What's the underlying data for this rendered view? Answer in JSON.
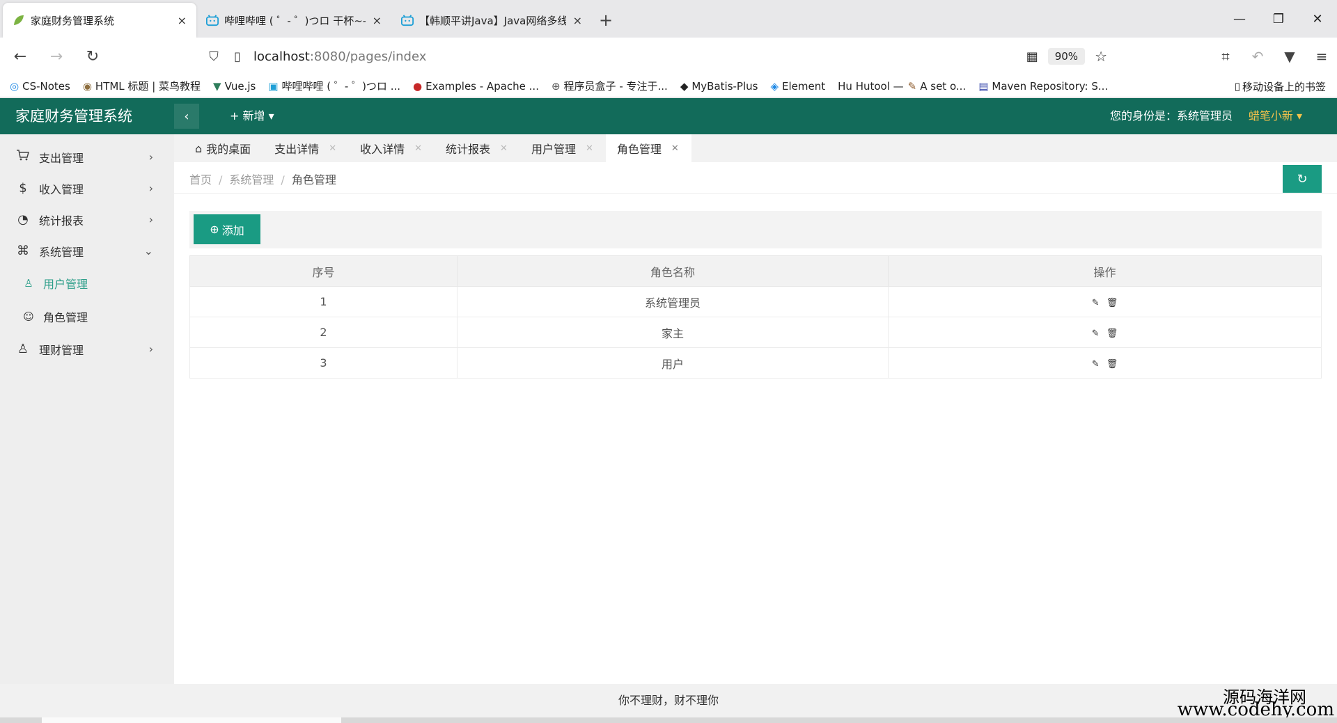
{
  "browser": {
    "tabs": [
      {
        "title": "家庭财务管理系统",
        "icon": "leaf-icon",
        "close": "×"
      },
      {
        "title": "哔哩哔哩 ( ゜- ゜)つロ 干杯~-bi",
        "icon": "bilibili-icon",
        "close": "×"
      },
      {
        "title": "【韩顺平讲Java】Java网络多线",
        "icon": "bilibili-icon",
        "close": "×"
      }
    ],
    "new_tab": "+",
    "url_host": "localhost",
    "url_rest": ":8080/pages/index",
    "zoom": "90%",
    "bookmarks": [
      {
        "label": "CS-Notes",
        "icon": "◎"
      },
      {
        "label": "HTML 标题 | 菜鸟教程",
        "icon": "◉"
      },
      {
        "label": "Vue.js",
        "icon": "▼"
      },
      {
        "label": "哔哩哔哩 ( ゜- ゜)つロ ...",
        "icon": "▣"
      },
      {
        "label": "Examples - Apache ...",
        "icon": "●"
      },
      {
        "label": "程序员盒子 - 专注于...",
        "icon": "⊕"
      },
      {
        "label": "MyBatis-Plus",
        "icon": "◆"
      },
      {
        "label": "Element",
        "icon": "◈"
      },
      {
        "label": "Hu Hutool —",
        "icon": ""
      },
      {
        "label": "A set o...",
        "icon": "✎"
      },
      {
        "label": "Maven Repository: S...",
        "icon": "▤"
      }
    ],
    "mobile_bookmarks": "移动设备上的书签"
  },
  "app": {
    "title": "家庭财务管理系统",
    "add_new": "+ 新增 ▾",
    "identity_label": "您的身份是：系统管理员",
    "username": "蜡笔小新 ▾"
  },
  "sidebar": {
    "items": [
      {
        "label": "支出管理",
        "icon": "cart-icon",
        "glyph": "🛒",
        "arrow": "›"
      },
      {
        "label": "收入管理",
        "icon": "dollar-icon",
        "glyph": "$",
        "arrow": "›"
      },
      {
        "label": "统计报表",
        "icon": "dashboard-icon",
        "glyph": "◔",
        "arrow": "›"
      },
      {
        "label": "系统管理",
        "icon": "apps-icon",
        "glyph": "⌘",
        "arrow": "⌄"
      }
    ],
    "subitems": [
      {
        "label": "用户管理",
        "glyph": "♙",
        "active": true
      },
      {
        "label": "角色管理",
        "glyph": "☺",
        "active": false
      }
    ],
    "last_item": {
      "label": "理财管理",
      "glyph": "♙",
      "arrow": "›"
    }
  },
  "content_tabs": [
    {
      "label": "我的桌面",
      "home": true
    },
    {
      "label": "支出详情"
    },
    {
      "label": "收入详情"
    },
    {
      "label": "统计报表"
    },
    {
      "label": "用户管理"
    },
    {
      "label": "角色管理",
      "active": true
    }
  ],
  "breadcrumb": {
    "home": "首页",
    "section": "系统管理",
    "current": "角色管理",
    "separator": "/"
  },
  "refresh_glyph": "↻",
  "add_button": "添加",
  "table": {
    "headers": [
      "序号",
      "角色名称",
      "操作"
    ],
    "rows": [
      {
        "index": "1",
        "name": "系统管理员"
      },
      {
        "index": "2",
        "name": "家主"
      },
      {
        "index": "3",
        "name": "用户"
      }
    ]
  },
  "footer": "你不理财，财不理你",
  "watermark": {
    "line1": "源码海洋网",
    "line2": "www.codehy.com"
  }
}
